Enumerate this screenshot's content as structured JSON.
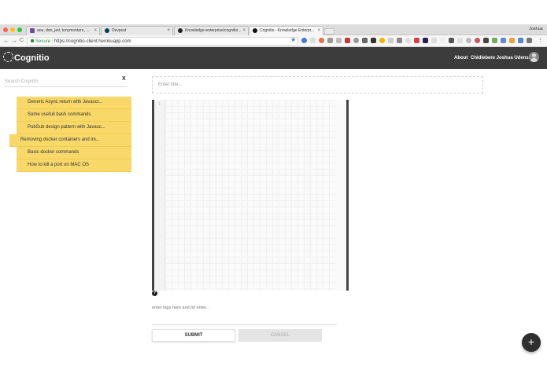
{
  "browser": {
    "tabs": [
      {
        "label": "anu, don_jed, tonymontaro, ..."
      },
      {
        "label": "Devpost"
      },
      {
        "label": "Knowledge-enterprise/cognitio..."
      },
      {
        "label": "Cognitio - Knowledge Enterpr..."
      }
    ],
    "profile_name": "Joshua",
    "secure_label": "Secure",
    "url": "https://cognitio-client.herokuapp.com",
    "back_glyph": "←",
    "forward_glyph": "→",
    "reload_glyph": "C",
    "star_glyph": "★",
    "close_glyph": "×"
  },
  "app": {
    "brand": "Cognitio",
    "nav": {
      "about": "About",
      "user_name": "Chidiebere Joshua Udensi"
    }
  },
  "sidebar": {
    "search_placeholder": "Search Cognitio",
    "clear_label": "X",
    "notes": [
      {
        "label": "Generic Async return with Javascr..."
      },
      {
        "label": "Some usefull bash commands"
      },
      {
        "label": "PubSub design pattern with Javasc..."
      },
      {
        "label": "Removing docker containers and im..."
      },
      {
        "label": "Basic docker commands"
      },
      {
        "label": "How to kill a port on MAC OS"
      }
    ]
  },
  "editor": {
    "title_placeholder": "Enter title...",
    "line_number": "1",
    "help_glyph": "?",
    "tags_placeholder": "enter tags here and hit enter..",
    "submit_label": "SUBMIT",
    "cancel_label": "CANCEL",
    "fab_glyph": "+"
  }
}
